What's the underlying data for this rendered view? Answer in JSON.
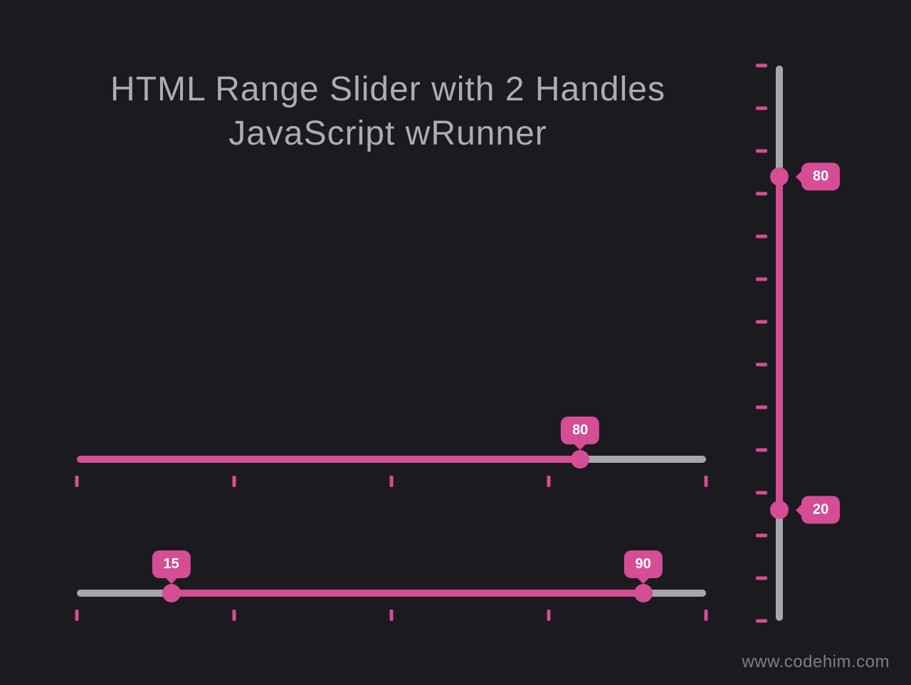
{
  "heading": {
    "line1": "HTML Range Slider with 2 Handles",
    "line2": "JavaScript wRunner"
  },
  "slider1": {
    "min": 0,
    "max": 100,
    "value": 80,
    "value_label": "80",
    "tick_count": 5
  },
  "slider2": {
    "min": 0,
    "max": 100,
    "low": 15,
    "high": 90,
    "low_label": "15",
    "high_label": "90",
    "tick_count": 5
  },
  "vslider": {
    "min": 0,
    "max": 100,
    "low": 20,
    "high": 80,
    "low_label": "20",
    "high_label": "80",
    "tick_count": 14
  },
  "footer": {
    "text": "www.codehim.com"
  }
}
